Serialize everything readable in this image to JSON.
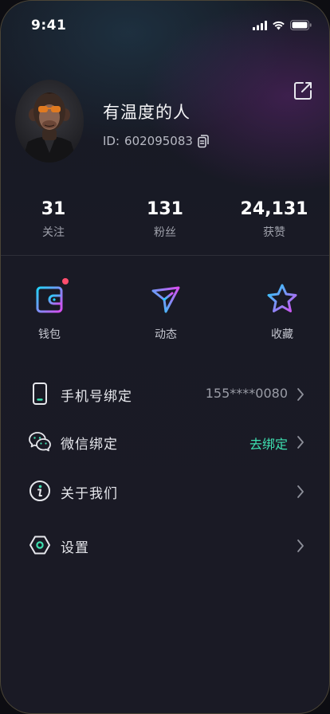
{
  "status_bar": {
    "time": "9:41"
  },
  "profile": {
    "username": "有温度的人",
    "id_label": "ID:",
    "id_value": "602095083"
  },
  "stats": [
    {
      "value": "31",
      "label": "关注"
    },
    {
      "value": "131",
      "label": "粉丝"
    },
    {
      "value": "24,131",
      "label": "获赞"
    }
  ],
  "actions": [
    {
      "label": "钱包",
      "icon": "wallet-icon",
      "has_badge": true
    },
    {
      "label": "动态",
      "icon": "send-icon",
      "has_badge": false
    },
    {
      "label": "收藏",
      "icon": "star-icon",
      "has_badge": false
    }
  ],
  "menu": [
    {
      "label": "手机号绑定",
      "value": "155****0080",
      "icon": "phone-icon"
    },
    {
      "label": "微信绑定",
      "value": "去绑定",
      "icon": "wechat-icon"
    },
    {
      "label": "关于我们",
      "value": "",
      "icon": "info-icon"
    },
    {
      "label": "设置",
      "value": "",
      "icon": "settings-icon"
    }
  ],
  "colors": {
    "background": "#1a1a25",
    "accent_green": "#3ee0b0",
    "gradient_cyan": "#21d4fd",
    "gradient_magenta": "#d94cf0",
    "badge_red": "#ff4d6d"
  }
}
